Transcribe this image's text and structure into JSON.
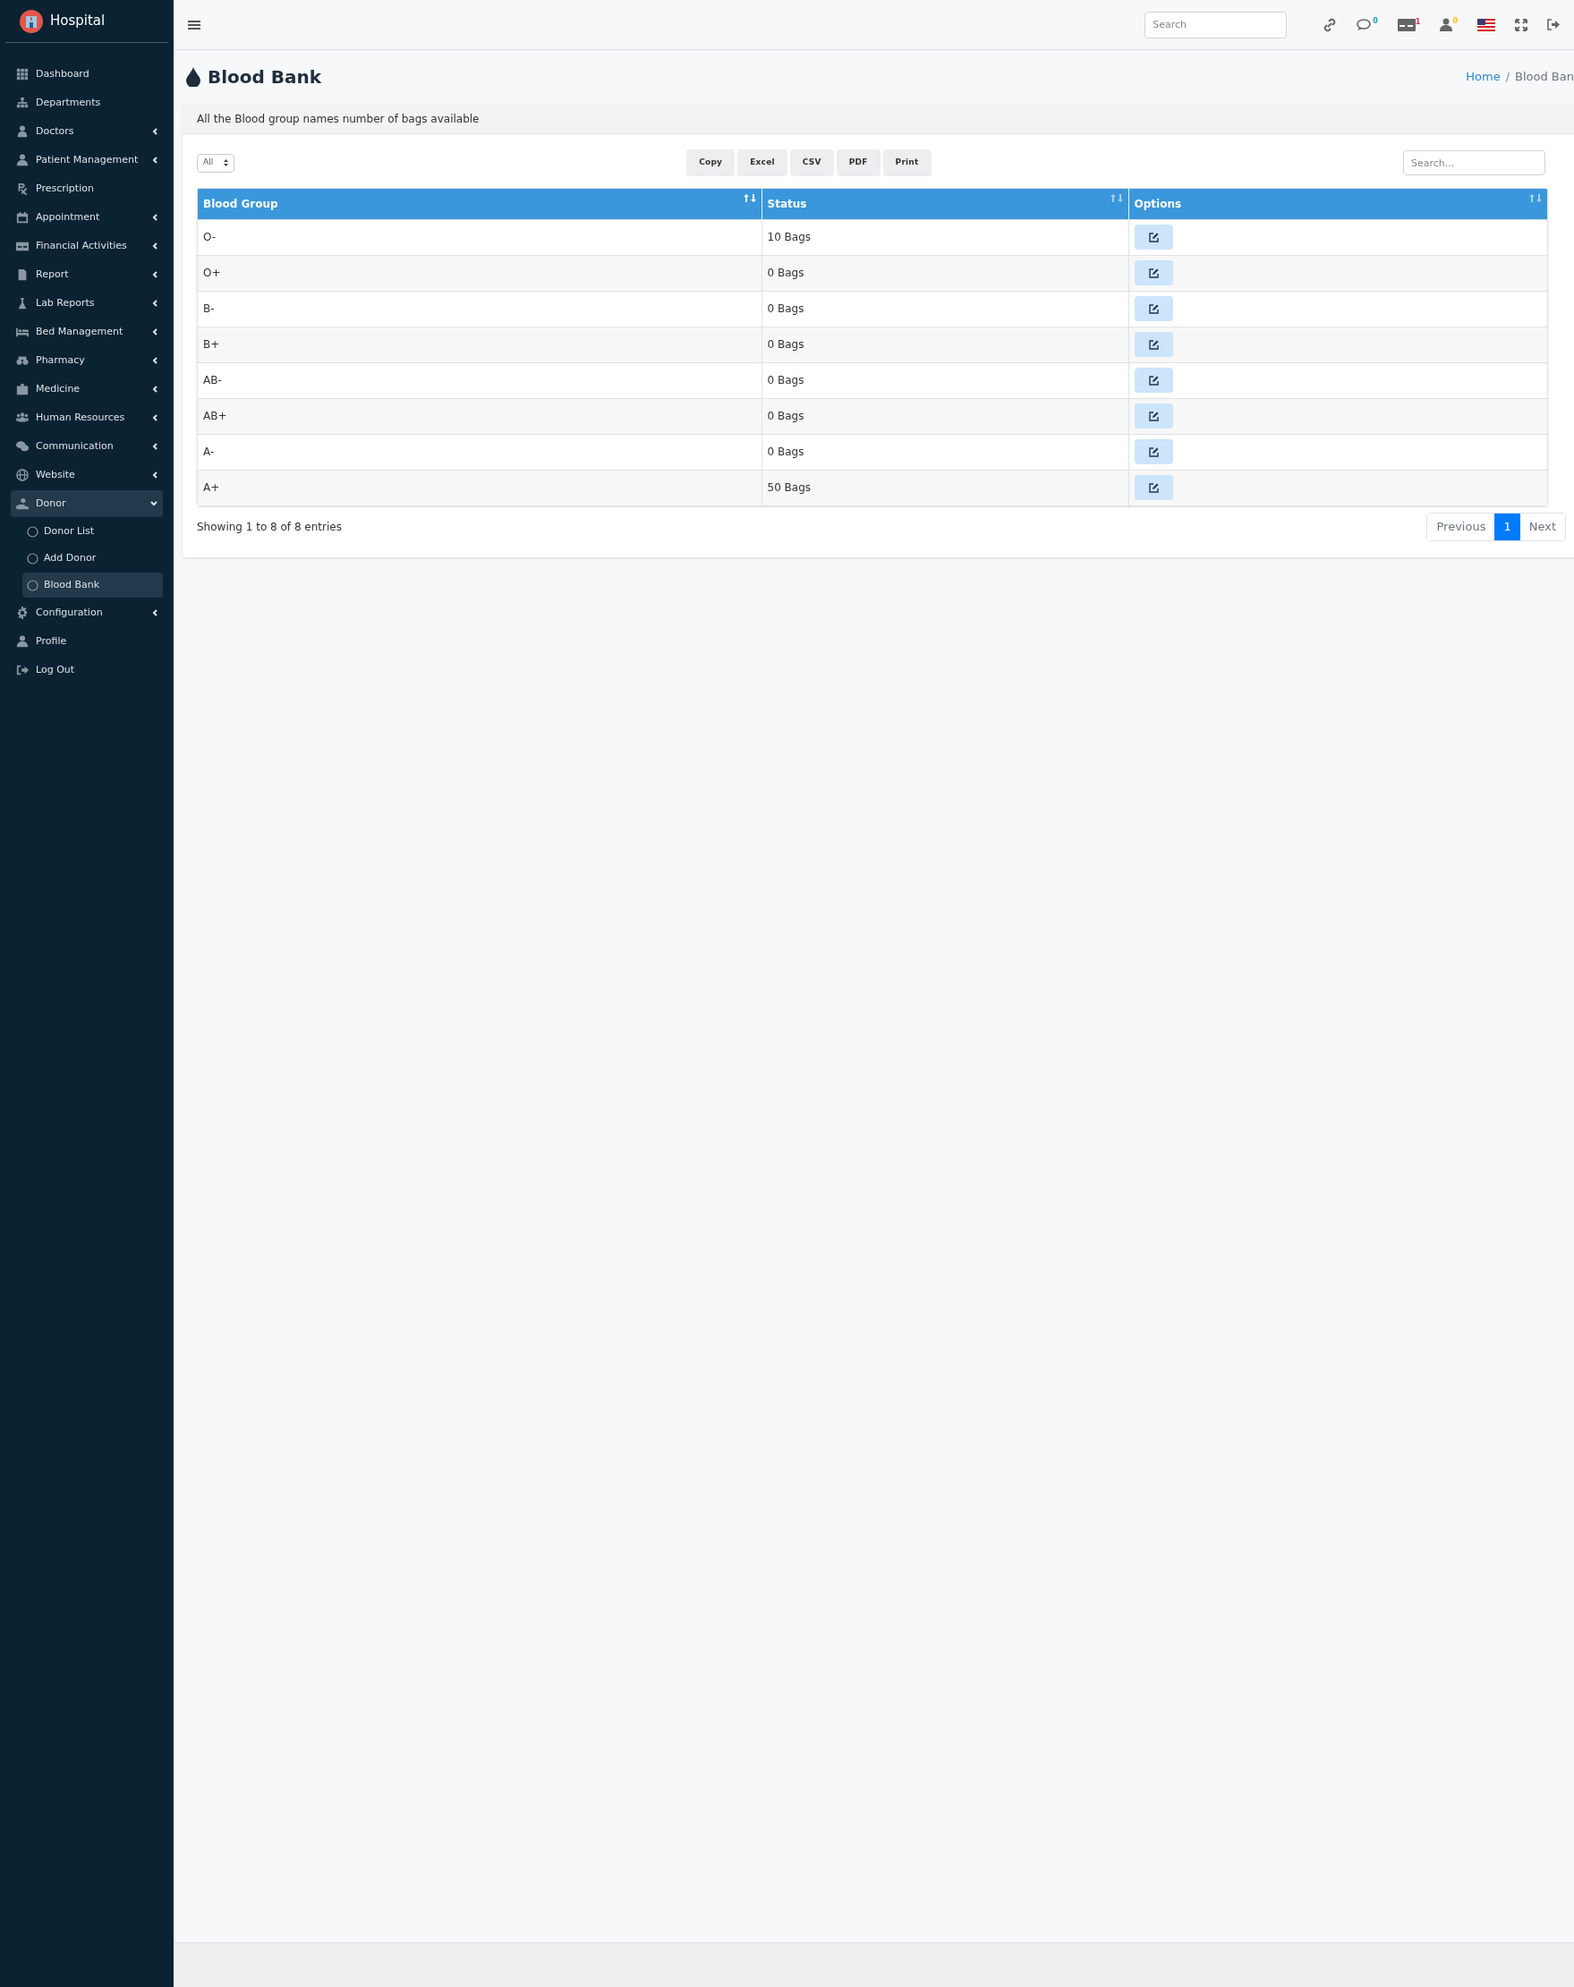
{
  "brand": {
    "name": "Hospital"
  },
  "sidebar": {
    "items": [
      {
        "label": "Dashboard",
        "kind": "link",
        "selected": false
      },
      {
        "label": "Departments",
        "kind": "link",
        "selected": false
      },
      {
        "label": "Doctors",
        "kind": "menu",
        "expanded": false,
        "selected": false
      },
      {
        "label": "Patient Management",
        "kind": "menu",
        "expanded": false,
        "selected": false
      },
      {
        "label": "Prescription",
        "kind": "link",
        "selected": false
      },
      {
        "label": "Appointment",
        "kind": "menu",
        "expanded": false,
        "selected": false
      },
      {
        "label": "Financial Activities",
        "kind": "menu",
        "expanded": false,
        "selected": false
      },
      {
        "label": "Report",
        "kind": "menu",
        "expanded": false,
        "selected": false
      },
      {
        "label": "Lab Reports",
        "kind": "menu",
        "expanded": false,
        "selected": false
      },
      {
        "label": "Bed Management",
        "kind": "menu",
        "expanded": false,
        "selected": false
      },
      {
        "label": "Pharmacy",
        "kind": "menu",
        "expanded": false,
        "selected": false
      },
      {
        "label": "Medicine",
        "kind": "menu",
        "expanded": false,
        "selected": false
      },
      {
        "label": "Human Resources",
        "kind": "menu",
        "expanded": false,
        "selected": false
      },
      {
        "label": "Communication",
        "kind": "menu",
        "expanded": false,
        "selected": false
      },
      {
        "label": "Website",
        "kind": "menu",
        "expanded": false,
        "selected": false
      },
      {
        "label": "Donor",
        "kind": "menu",
        "expanded": true,
        "selected": true,
        "children": [
          {
            "label": "Donor List",
            "selected": false
          },
          {
            "label": "Add Donor",
            "selected": false
          },
          {
            "label": "Blood Bank",
            "selected": true
          }
        ]
      },
      {
        "label": "Configuration",
        "kind": "menu",
        "expanded": false,
        "selected": false
      },
      {
        "label": "Profile",
        "kind": "link",
        "selected": false
      },
      {
        "label": "Log Out",
        "kind": "link",
        "selected": false
      }
    ]
  },
  "topbar": {
    "search": {
      "placeholder": "Search"
    },
    "badges": [
      {
        "text": "0",
        "color": "#17a2b8"
      },
      {
        "text": "1",
        "color": "#dc3545"
      },
      {
        "text": "0",
        "color": "#ffc107"
      }
    ]
  },
  "page": {
    "title": "Blood Bank",
    "breadcrumb": [
      {
        "label": "Home"
      },
      {
        "label": "Blood Ban",
        "separator": "/"
      }
    ]
  },
  "card": {
    "header": "All the Blood group names number of bags available",
    "length_select": {
      "value": "All"
    },
    "export_buttons": [
      "Copy",
      "Excel",
      "CSV",
      "PDF",
      "Print"
    ],
    "search": {
      "placeholder": "Search..."
    },
    "table": {
      "columns": [
        "Blood Group",
        "Status",
        "Options"
      ],
      "rows": [
        {
          "blood_group": "O-",
          "status": "10 Bags"
        },
        {
          "blood_group": "O+",
          "status": "0 Bags"
        },
        {
          "blood_group": "B-",
          "status": "0 Bags"
        },
        {
          "blood_group": "B+",
          "status": "0 Bags"
        },
        {
          "blood_group": "AB-",
          "status": "0 Bags"
        },
        {
          "blood_group": "AB+",
          "status": "0 Bags"
        },
        {
          "blood_group": "A-",
          "status": "0 Bags"
        },
        {
          "blood_group": "A+",
          "status": "50 Bags"
        }
      ]
    },
    "info": "Showing 1 to 8 of 8 entries",
    "pagination": [
      {
        "label": "Previous",
        "selected": false
      },
      {
        "label": "1",
        "selected": true
      },
      {
        "label": "Next",
        "selected": false
      }
    ]
  }
}
